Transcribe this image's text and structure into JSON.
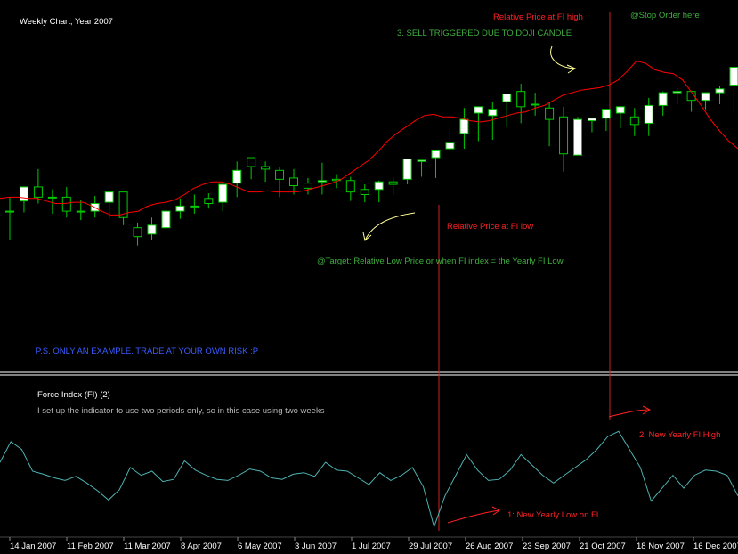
{
  "chart_data": [
    {
      "type": "candlestick",
      "title": "Weekly Chart, Year 2007",
      "x_tick_labels": [
        "14 Jan 2007",
        "11 Feb 2007",
        "11 Mar 2007",
        "8 Apr 2007",
        "6 May 2007",
        "3 Jun 2007",
        "1 Jul 2007",
        "29 Jul 2007",
        "26 Aug 2007",
        "23 Sep 2007",
        "21 Oct 2007",
        "18 Nov 2007",
        "16 Dec 2007"
      ],
      "ylim": [
        0,
        100
      ],
      "candles": [
        {
          "o": 37,
          "h": 48,
          "l": 14,
          "c": 37
        },
        {
          "o": 45,
          "h": 55,
          "l": 36,
          "c": 56
        },
        {
          "o": 56,
          "h": 70,
          "l": 43,
          "c": 48
        },
        {
          "o": 48,
          "h": 54,
          "l": 35,
          "c": 48
        },
        {
          "o": 48,
          "h": 56,
          "l": 32,
          "c": 37
        },
        {
          "o": 37,
          "h": 46,
          "l": 30,
          "c": 37
        },
        {
          "o": 37,
          "h": 49,
          "l": 32,
          "c": 43
        },
        {
          "o": 44,
          "h": 52,
          "l": 31,
          "c": 52
        },
        {
          "o": 52,
          "h": 52,
          "l": 26,
          "c": 32
        },
        {
          "o": 24,
          "h": 28,
          "l": 10,
          "c": 17
        },
        {
          "o": 19,
          "h": 32,
          "l": 14,
          "c": 26
        },
        {
          "o": 24,
          "h": 40,
          "l": 22,
          "c": 37
        },
        {
          "o": 37,
          "h": 47,
          "l": 31,
          "c": 41
        },
        {
          "o": 41,
          "h": 50,
          "l": 35,
          "c": 41
        },
        {
          "o": 47,
          "h": 51,
          "l": 39,
          "c": 43
        },
        {
          "o": 44,
          "h": 55,
          "l": 37,
          "c": 58
        },
        {
          "o": 59,
          "h": 76,
          "l": 48,
          "c": 69
        },
        {
          "o": 79,
          "h": 78,
          "l": 62,
          "c": 72
        },
        {
          "o": 72,
          "h": 76,
          "l": 60,
          "c": 70
        },
        {
          "o": 69,
          "h": 72,
          "l": 48,
          "c": 62
        },
        {
          "o": 63,
          "h": 70,
          "l": 50,
          "c": 57
        },
        {
          "o": 59,
          "h": 63,
          "l": 50,
          "c": 55
        },
        {
          "o": 60,
          "h": 75,
          "l": 50,
          "c": 61
        },
        {
          "o": 62,
          "h": 66,
          "l": 55,
          "c": 61
        },
        {
          "o": 61,
          "h": 64,
          "l": 45,
          "c": 52
        },
        {
          "o": 54,
          "h": 58,
          "l": 44,
          "c": 50
        },
        {
          "o": 54,
          "h": 61,
          "l": 44,
          "c": 60
        },
        {
          "o": 60,
          "h": 63,
          "l": 50,
          "c": 58
        },
        {
          "o": 62,
          "h": 75,
          "l": 58,
          "c": 78
        },
        {
          "o": 76,
          "h": 76,
          "l": 64,
          "c": 77
        },
        {
          "o": 79,
          "h": 82,
          "l": 63,
          "c": 85
        },
        {
          "o": 86,
          "h": 102,
          "l": 84,
          "c": 91
        },
        {
          "o": 98,
          "h": 118,
          "l": 86,
          "c": 109
        },
        {
          "o": 114,
          "h": 115,
          "l": 92,
          "c": 119
        },
        {
          "o": 112,
          "h": 123,
          "l": 93,
          "c": 117
        },
        {
          "o": 123,
          "h": 124,
          "l": 103,
          "c": 129
        },
        {
          "o": 131,
          "h": 137,
          "l": 106,
          "c": 119
        },
        {
          "o": 121,
          "h": 130,
          "l": 112,
          "c": 121
        },
        {
          "o": 118,
          "h": 123,
          "l": 88,
          "c": 109
        },
        {
          "o": 111,
          "h": 119,
          "l": 68,
          "c": 82
        },
        {
          "o": 81,
          "h": 111,
          "l": 81,
          "c": 109
        },
        {
          "o": 108,
          "h": 109,
          "l": 99,
          "c": 110
        },
        {
          "o": 110,
          "h": 116,
          "l": 100,
          "c": 117
        },
        {
          "o": 114,
          "h": 115,
          "l": 102,
          "c": 119
        },
        {
          "o": 111,
          "h": 118,
          "l": 96,
          "c": 105
        },
        {
          "o": 106,
          "h": 126,
          "l": 96,
          "c": 120
        },
        {
          "o": 120,
          "h": 131,
          "l": 112,
          "c": 130
        },
        {
          "o": 130,
          "h": 134,
          "l": 121,
          "c": 131
        },
        {
          "o": 131,
          "h": 130,
          "l": 115,
          "c": 124
        },
        {
          "o": 124,
          "h": 130,
          "l": 117,
          "c": 130
        },
        {
          "o": 130,
          "h": 135,
          "l": 121,
          "c": 133
        },
        {
          "o": 136,
          "h": 151,
          "l": 114,
          "c": 150
        },
        {
          "o": 149,
          "h": 150,
          "l": 132,
          "c": 150
        },
        {
          "o": 149,
          "h": 166,
          "l": 145,
          "c": 146
        },
        {
          "o": 145,
          "h": 149,
          "l": 124,
          "c": 133
        },
        {
          "o": 137,
          "h": 137,
          "l": 125,
          "c": 133
        },
        {
          "o": 133,
          "h": 138,
          "l": 125,
          "c": 136
        },
        {
          "o": 137,
          "h": 140,
          "l": 111,
          "c": 128
        },
        {
          "o": 128,
          "h": 136,
          "l": 115,
          "c": 120
        },
        {
          "o": 118,
          "h": 124,
          "l": 100,
          "c": 103
        },
        {
          "o": 103,
          "h": 106,
          "l": 88,
          "c": 88
        },
        {
          "o": 93,
          "h": 102,
          "l": 88,
          "c": 94
        },
        {
          "o": 95,
          "h": 96,
          "l": 86,
          "c": 86
        },
        {
          "o": 86,
          "h": 92,
          "l": 78,
          "c": 80
        }
      ],
      "series": [
        {
          "name": "",
          "values": [
            47,
            48,
            48,
            47,
            47,
            45,
            43,
            43,
            44,
            44,
            41,
            37,
            34,
            34,
            36,
            37,
            41,
            43,
            44,
            46,
            50,
            55,
            58,
            60,
            60,
            58,
            55,
            52,
            52,
            53,
            52,
            52,
            52,
            53,
            55,
            57,
            59,
            62,
            67,
            72,
            77,
            84,
            92,
            98,
            103,
            108,
            112,
            113,
            111,
            111,
            110,
            108,
            107,
            108,
            110,
            112,
            114,
            115,
            118,
            120,
            124,
            128,
            130,
            132,
            133,
            134,
            136,
            140,
            147,
            155,
            153,
            148,
            146,
            145,
            140,
            130,
            120,
            109,
            100,
            92,
            86
          ]
        }
      ]
    },
    {
      "type": "line",
      "title": "Force Index (FI) (2)",
      "ylim": [
        -100,
        100
      ],
      "series": [
        {
          "name": "",
          "values": [
            5,
            45,
            30,
            -12,
            -18,
            -25,
            -30,
            -22,
            -35,
            -50,
            -68,
            -48,
            -5,
            -20,
            -12,
            -32,
            -28,
            8,
            -10,
            -20,
            -28,
            -30,
            -20,
            -8,
            -12,
            -25,
            -28,
            -18,
            -15,
            -22,
            5,
            -10,
            -12,
            -25,
            -38,
            -15,
            -30,
            -20,
            -5,
            -42,
            -120,
            -60,
            -20,
            20,
            -10,
            -30,
            -28,
            -10,
            20,
            0,
            -20,
            -35,
            -20,
            -5,
            10,
            30,
            55,
            65,
            30,
            -5,
            -70,
            -45,
            -20,
            -45,
            -20,
            -10,
            -12,
            -20,
            -60
          ]
        }
      ]
    }
  ],
  "annotations": {
    "sell_trigger": "3. SELL TRIGGERED DUE TO DOJI CANDLE",
    "relative_high": "Relative Price at FI high",
    "stop_order": "@Stop Order here",
    "relative_low": "Relative Price at FI low",
    "target": "@Target: Relative Low Price or when FI index = the Yearly FI Low",
    "disclaimer": "P.S. ONLY AN EXAMPLE. TRADE AT YOUR OWN RISK :P",
    "fi_note": "I set up the indicator to use two periods only, so in this case using two weeks",
    "new_yearly_high": "2: New Yearly FI High",
    "new_yearly_low": "1: New Yearly Low on FI"
  },
  "colors": {
    "up_candle": "#ffffff",
    "down_candle": "#000000",
    "wick": "#00cc00",
    "moving_average": "#ff0000",
    "fi_line": "#4fb3b3",
    "green_text": "#3fae3f",
    "red_text": "#ff2222",
    "blue_text": "#3a5bff",
    "gray_text": "#b8b8b8",
    "marker_line": "#cc2222"
  }
}
